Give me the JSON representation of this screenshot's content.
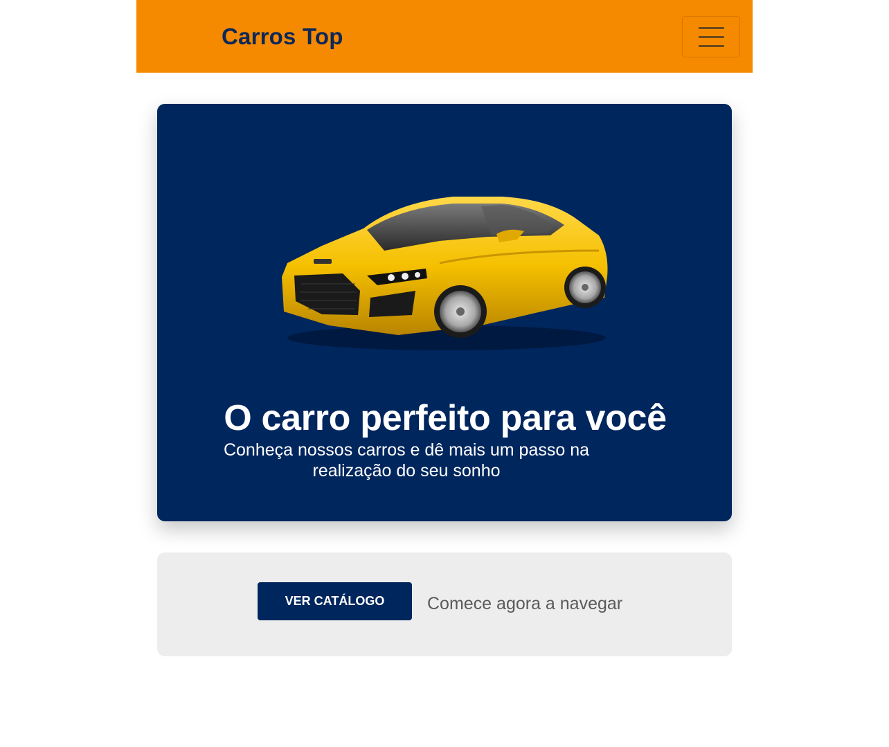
{
  "navbar": {
    "brand": "Carros Top",
    "menu_icon": "hamburger-menu-icon",
    "background_color": "#f58a00",
    "brand_color": "#0d2759"
  },
  "hero": {
    "title": "O carro perfeito para você",
    "subtitle": "Conheça nossos carros e dê mais um passo na realização do seu sonho",
    "image": "yellow-sports-car",
    "background_color": "#00265e"
  },
  "cta": {
    "button_label": "VER CATÁLOGO",
    "text": "Comece agora a navegar",
    "background_color": "#ededed"
  }
}
